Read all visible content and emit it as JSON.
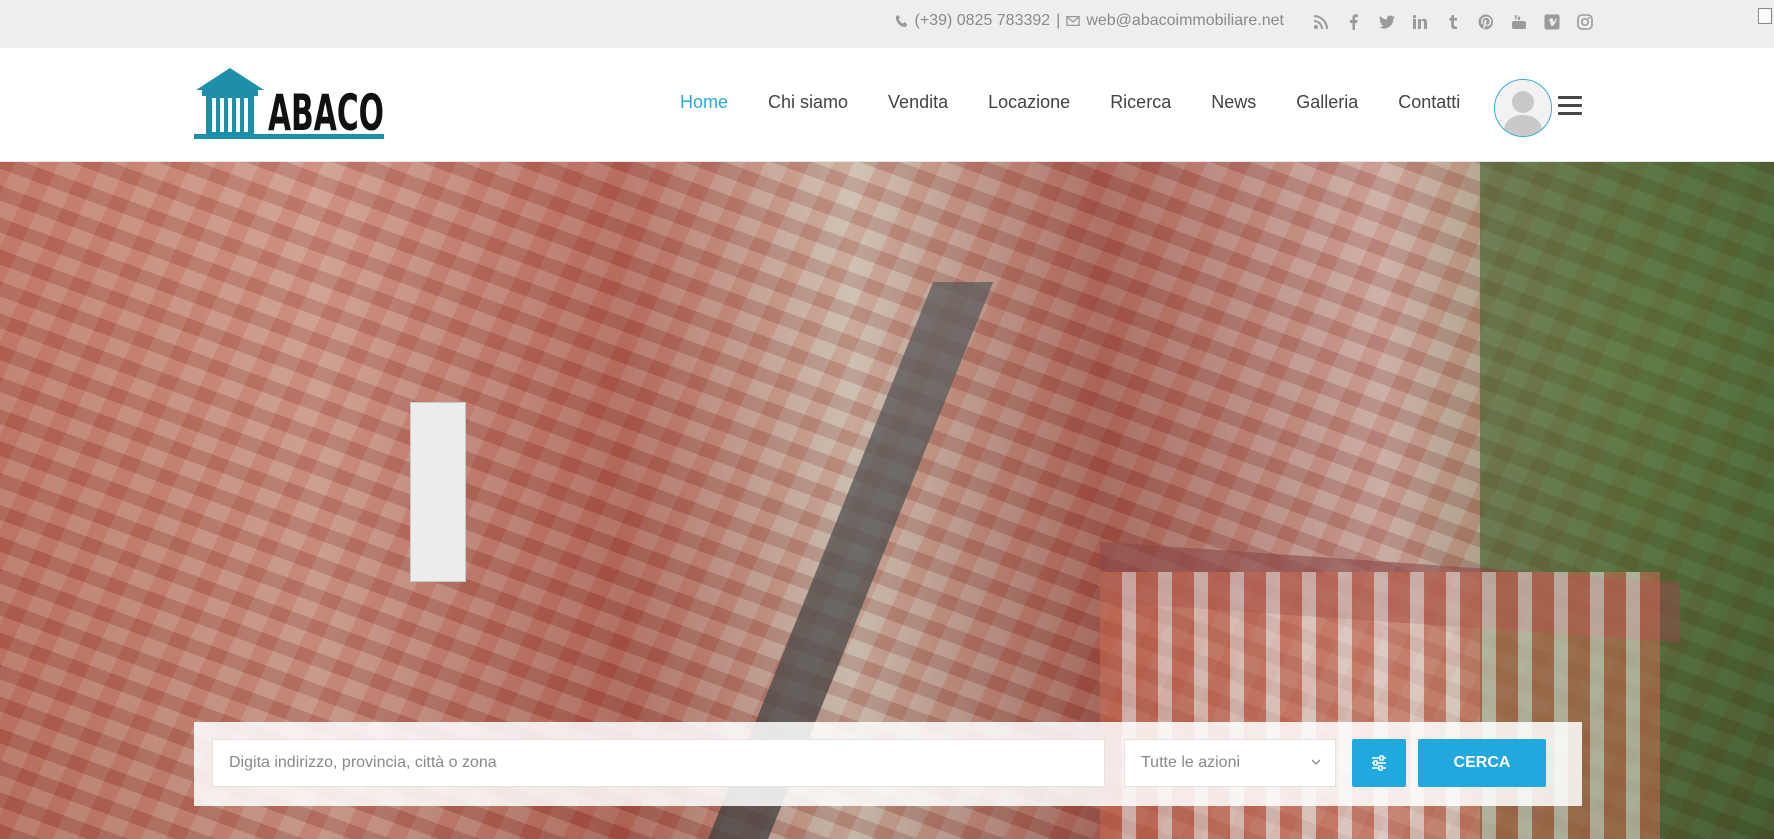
{
  "topbar": {
    "phone": "(+39) 0825 783392",
    "separator": "|",
    "email": "web@abacoimmobiliare.net",
    "social_icons": [
      "rss-icon",
      "facebook-icon",
      "twitter-icon",
      "linkedin-icon",
      "tumblr-icon",
      "pinterest-icon",
      "youtube-icon",
      "vimeo-icon",
      "instagram-icon"
    ]
  },
  "header": {
    "logo_text": "ABACO",
    "nav": [
      {
        "label": "Home",
        "active": true
      },
      {
        "label": "Chi siamo"
      },
      {
        "label": "Vendita"
      },
      {
        "label": "Locazione"
      },
      {
        "label": "Ricerca"
      },
      {
        "label": "News"
      },
      {
        "label": "Galleria"
      },
      {
        "label": "Contatti"
      }
    ]
  },
  "search": {
    "placeholder": "Digita indirizzo, provincia, città o zona",
    "action_select": "Tutte le azioni",
    "button_label": "CERCA"
  },
  "colors": {
    "accent": "#20a8df",
    "logo_teal": "#1e8fa8",
    "topbar_bg": "#eeeeee"
  }
}
